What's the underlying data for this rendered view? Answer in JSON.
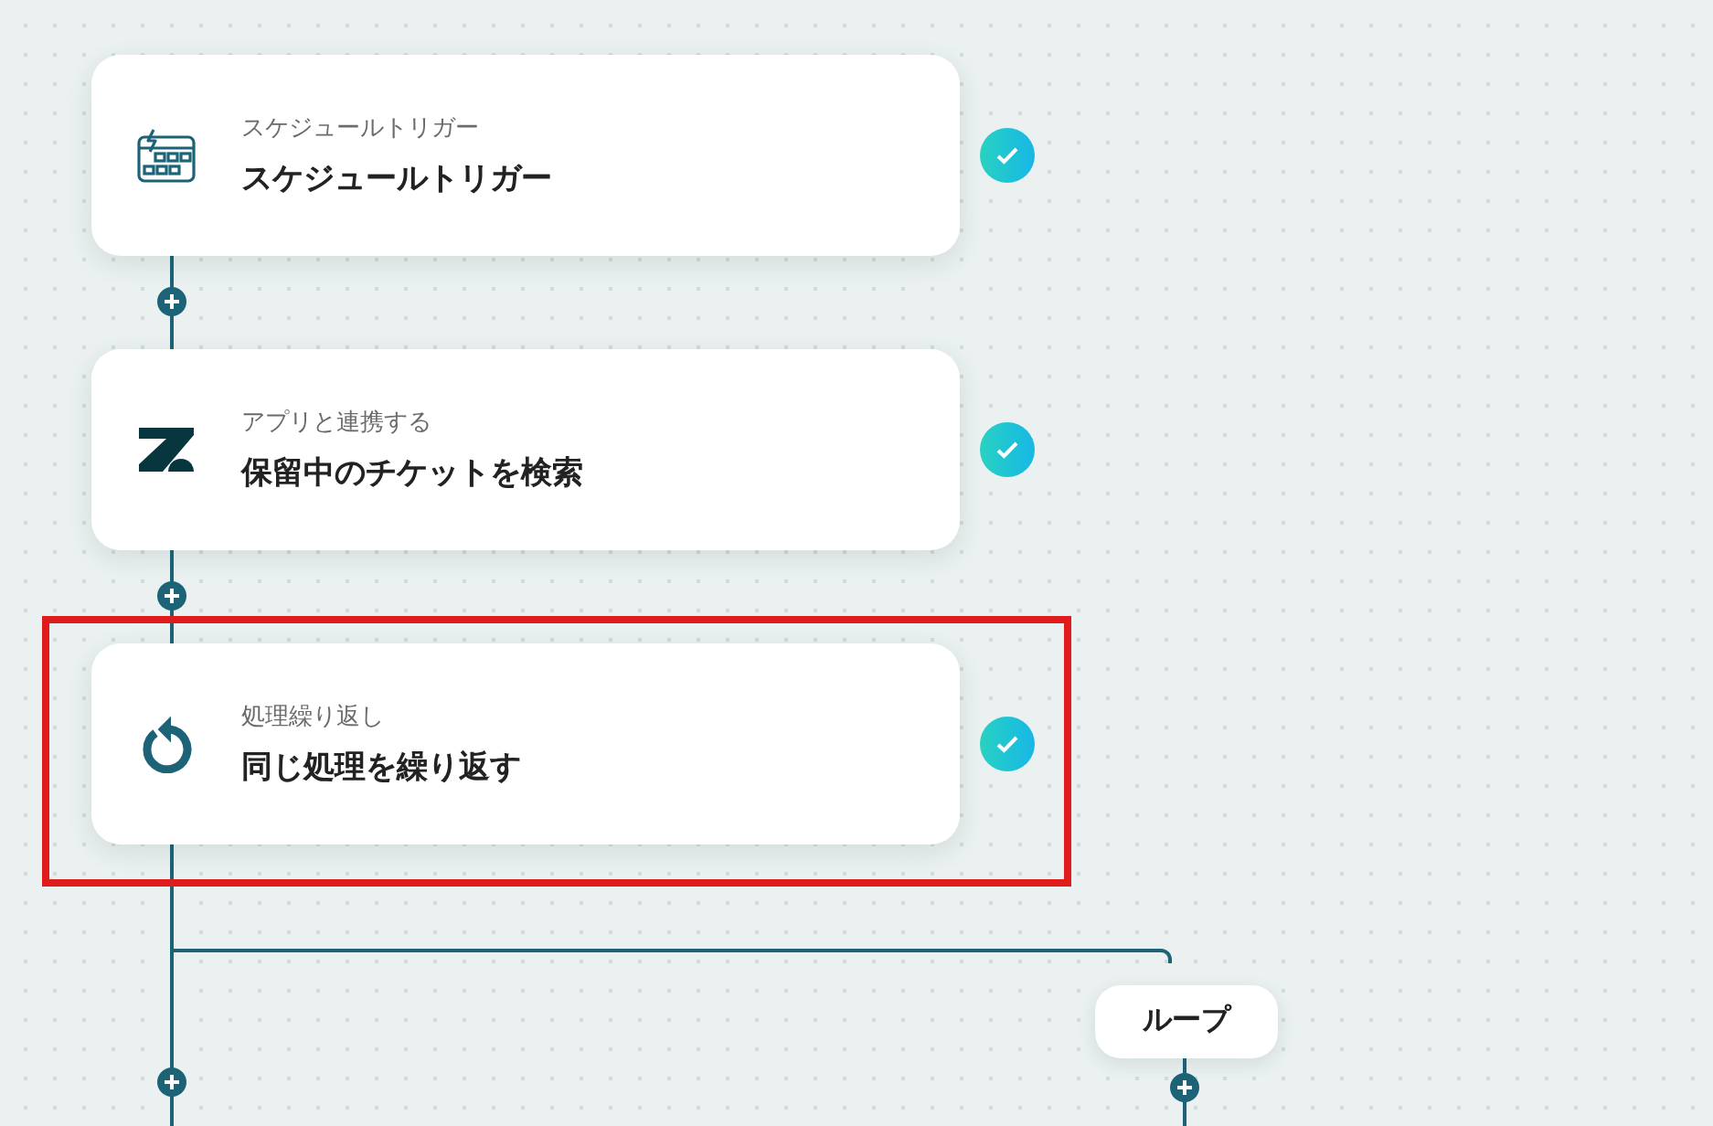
{
  "steps": [
    {
      "kind": "schedule",
      "caption": "スケジュールトリガー",
      "title": "スケジュールトリガー",
      "done": true,
      "highlighted": false
    },
    {
      "kind": "app",
      "caption": "アプリと連携する",
      "title": "保留中のチケットを検索",
      "done": true,
      "highlighted": false
    },
    {
      "kind": "loop",
      "caption": "処理繰り返し",
      "title": "同じ処理を繰り返す",
      "done": true,
      "highlighted": true
    }
  ],
  "branch": {
    "label": "ループ"
  }
}
